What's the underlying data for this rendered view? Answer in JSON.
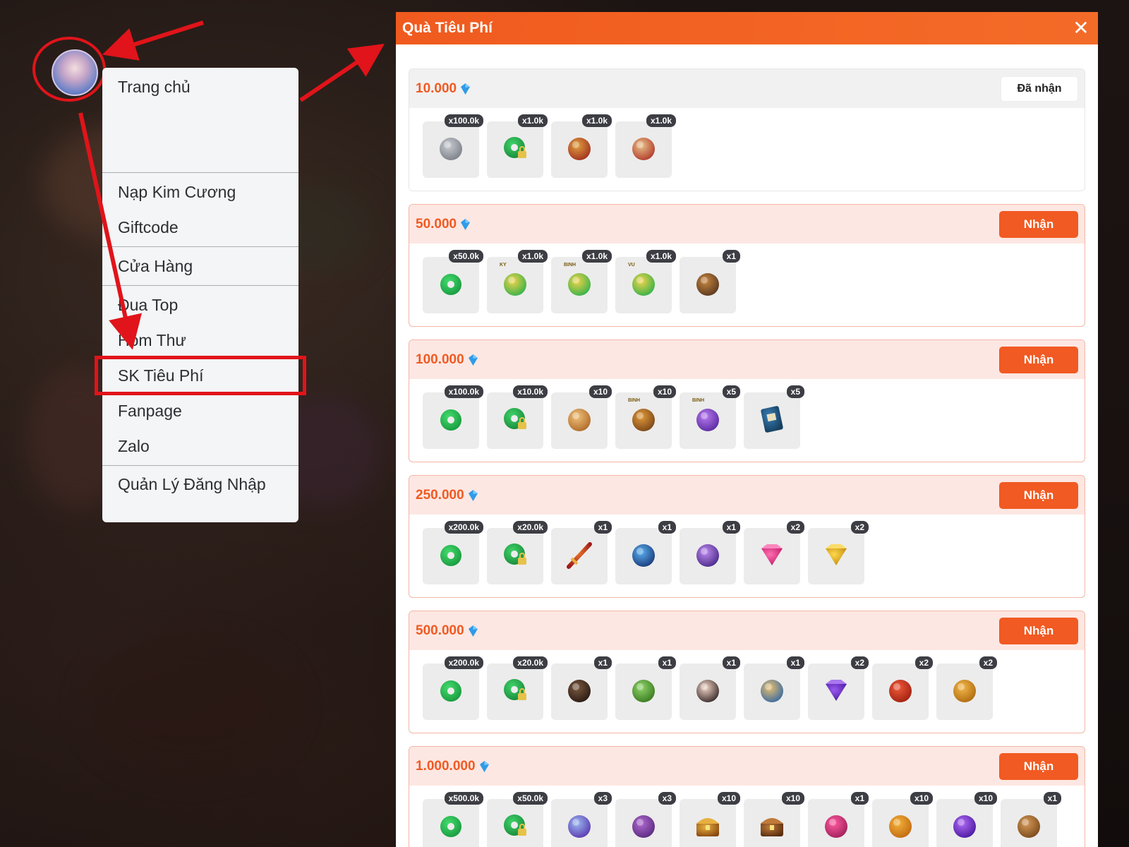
{
  "menu": {
    "items": [
      "Trang chủ",
      "Nạp Kim Cương",
      "Giftcode",
      "Cửa Hàng",
      "Đua Top",
      "Hòm Thư",
      "SK Tiêu Phí",
      "Fanpage",
      "Zalo",
      "Quản Lý Đăng Nhập"
    ],
    "highlighted": "SK Tiêu Phí"
  },
  "panel": {
    "title": "Quà Tiêu Phí",
    "tiers": [
      {
        "amount": "10.000",
        "button": "Đã nhận",
        "claimed": true,
        "items": [
          {
            "icon": "silver-ingot",
            "qty": "x100.0k"
          },
          {
            "icon": "jade-lock",
            "qty": "x1.0k"
          },
          {
            "icon": "medal-badge",
            "qty": "x1.0k"
          },
          {
            "icon": "cape-token",
            "qty": "x1.0k"
          }
        ]
      },
      {
        "amount": "50.000",
        "button": "Nhận",
        "claimed": false,
        "items": [
          {
            "icon": "jade-ring",
            "qty": "x50.0k"
          },
          {
            "icon": "gold-jade-ky",
            "qty": "x1.0k",
            "tag": "KY"
          },
          {
            "icon": "gold-jade-binh",
            "qty": "x1.0k",
            "tag": "BINH"
          },
          {
            "icon": "gold-jade-vu",
            "qty": "x1.0k",
            "tag": "VU"
          },
          {
            "icon": "eagle-pet",
            "qty": "x1"
          }
        ]
      },
      {
        "amount": "100.000",
        "button": "Nhận",
        "claimed": false,
        "items": [
          {
            "icon": "jade-ring",
            "qty": "x100.0k"
          },
          {
            "icon": "jade-lock",
            "qty": "x10.0k"
          },
          {
            "icon": "gold-seal",
            "qty": "x10"
          },
          {
            "icon": "bronze-orb",
            "qty": "x10",
            "tag": "BINH"
          },
          {
            "icon": "purple-orb",
            "qty": "x5",
            "tag": "BINH"
          },
          {
            "icon": "blue-book",
            "qty": "x5"
          }
        ]
      },
      {
        "amount": "250.000",
        "button": "Nhận",
        "claimed": false,
        "items": [
          {
            "icon": "jade-ring",
            "qty": "x200.0k"
          },
          {
            "icon": "jade-lock",
            "qty": "x20.0k"
          },
          {
            "icon": "flame-sword",
            "qty": "x1"
          },
          {
            "icon": "blue-qilin",
            "qty": "x1"
          },
          {
            "icon": "violet-fairy",
            "qty": "x1"
          },
          {
            "icon": "pink-gem",
            "qty": "x2"
          },
          {
            "icon": "yellow-gem",
            "qty": "x2"
          }
        ]
      },
      {
        "amount": "500.000",
        "button": "Nhận",
        "claimed": false,
        "items": [
          {
            "icon": "jade-ring",
            "qty": "x200.0k"
          },
          {
            "icon": "jade-lock",
            "qty": "x20.0k"
          },
          {
            "icon": "hero-portrait",
            "qty": "x1"
          },
          {
            "icon": "jade-bangle",
            "qty": "x1"
          },
          {
            "icon": "chibi-girl",
            "qty": "x1"
          },
          {
            "icon": "golden-mount",
            "qty": "x1"
          },
          {
            "icon": "purple-gem",
            "qty": "x2"
          },
          {
            "icon": "red-phoenix",
            "qty": "x2"
          },
          {
            "icon": "gold-phoenix",
            "qty": "x2"
          }
        ]
      },
      {
        "amount": "1.000.000",
        "button": "Nhận",
        "claimed": false,
        "items": [
          {
            "icon": "jade-ring",
            "qty": "x500.0k"
          },
          {
            "icon": "jade-lock",
            "qty": "x50.0k"
          },
          {
            "icon": "crystal-wings",
            "qty": "x3"
          },
          {
            "icon": "purple-flower",
            "qty": "x3"
          },
          {
            "icon": "gold-chest",
            "qty": "x10"
          },
          {
            "icon": "wood-chest",
            "qty": "x10"
          },
          {
            "icon": "pink-pouch",
            "qty": "x1"
          },
          {
            "icon": "gold-coin",
            "qty": "x10"
          },
          {
            "icon": "violet-orb",
            "qty": "x10"
          },
          {
            "icon": "bronze-lion",
            "qty": "x1"
          }
        ]
      }
    ]
  },
  "colors": {
    "accent": "#f15a22",
    "highlight_outline": "#e0141a"
  }
}
